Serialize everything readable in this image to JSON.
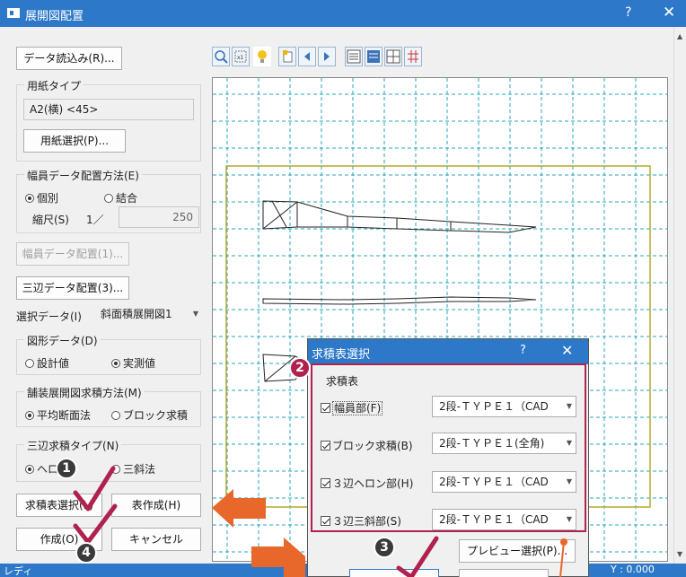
{
  "window": {
    "title": "展開図配置",
    "help": "?",
    "close": "✕"
  },
  "left": {
    "data_read": "データ読込み(R)...",
    "paper_type_label": "用紙タイプ",
    "paper_type_value": "A2(横) <45>",
    "paper_select": "用紙選択(P)...",
    "width_method_label": "幅員データ配置方法(E)",
    "width_method_opt1": "個別",
    "width_method_opt2": "結合",
    "scale_label": "縮尺(S)",
    "scale_one": "1／",
    "scale_value": "250",
    "width_place_btn": "幅員データ配置(1)...",
    "three_side_btn": "三辺データ配置(3)...",
    "select_data_label": "選択データ(I)",
    "select_data_value": "斜面積展開図1",
    "figure_data_label": "図形データ(D)",
    "figure_opt1": "設計値",
    "figure_opt2": "実測値",
    "pave_method_label": "舗装展開図求積方法(M)",
    "pave_opt1": "平均断面法",
    "pave_opt2": "ブロック求積",
    "tri_type_label": "三辺求積タイプ(N)",
    "tri_opt1": "ヘロ",
    "tri_opt2": "三斜法",
    "table_select_btn": "求積表選択(L)",
    "table_make_btn": "表作成(H)",
    "create_btn": "作成(O)",
    "cancel_btn": "キャンセル"
  },
  "dialog": {
    "title": "求積表選択",
    "help": "?",
    "close": "✕",
    "group_label": "求積表",
    "rows": [
      {
        "label": "幅員部(F)",
        "value": "2段-ＴＹＰＥ１（CAD"
      },
      {
        "label": "ブロック求積(B)",
        "value": "2段-ＴＹＰＥ１(全角)"
      },
      {
        "label": "３辺ヘロン部(H)",
        "value": "2段-ＴＹＰＥ１（CAD"
      },
      {
        "label": "３辺三斜部(S)",
        "value": "2段-ＴＹＰＥ１（CAD"
      }
    ],
    "preview_btn": "プレビュー選択(P)..."
  },
  "badges": {
    "b1": "1",
    "b2": "2",
    "b3": "3",
    "b4": "4"
  },
  "status": {
    "left": "レディ",
    "right": "Y : 0.000"
  },
  "colors": {
    "accent": "#2d78c8",
    "annotation_red": "#b0214e",
    "arrow": "#e8672a",
    "grid": "#2aa6b8",
    "frame": "#b3aa2a"
  }
}
